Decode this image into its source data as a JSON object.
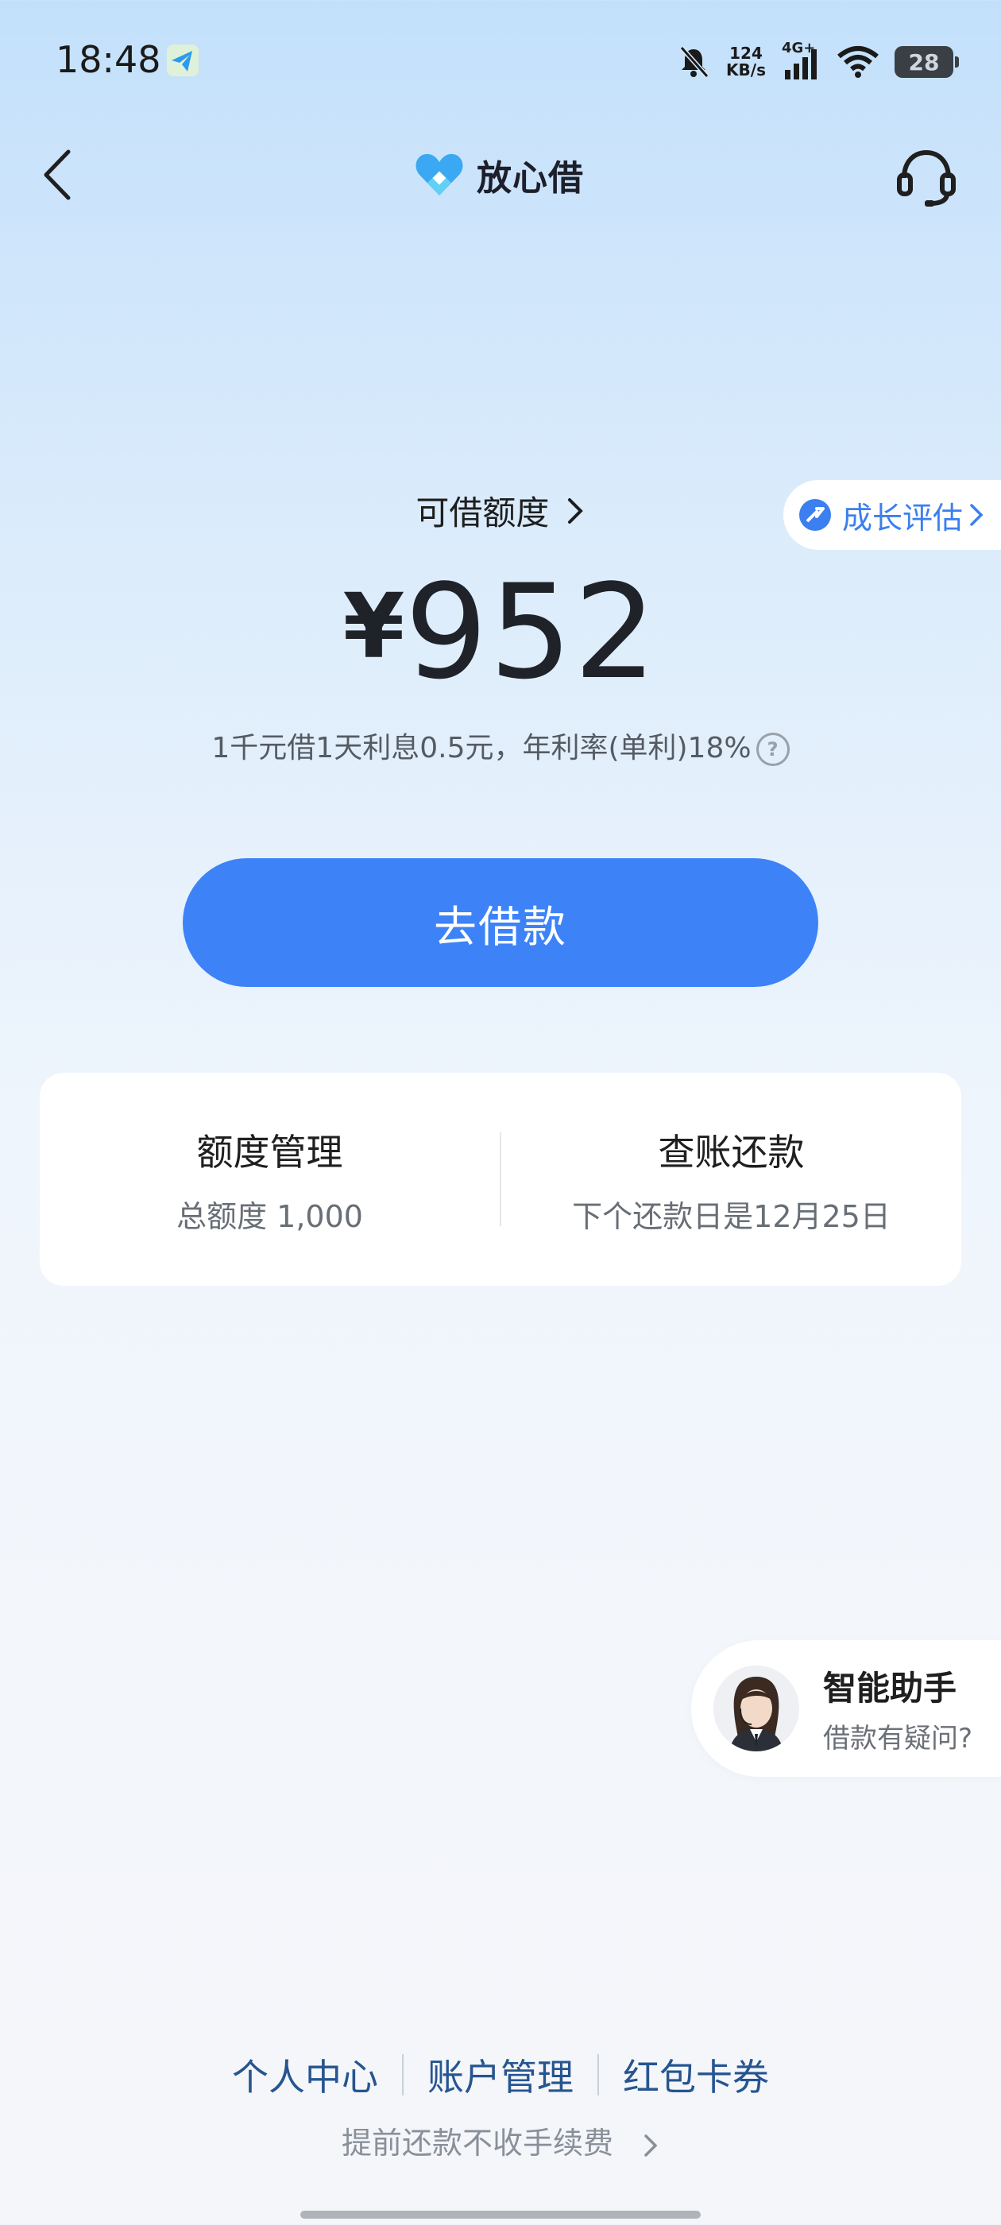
{
  "status_bar": {
    "time": "18:48",
    "net_speed_value": "124",
    "net_speed_unit": "KB/s",
    "network": "4G+",
    "battery": "28",
    "icons": [
      "telegram-icon",
      "mute-bell-icon",
      "signal-icon",
      "wifi-icon",
      "battery-icon"
    ]
  },
  "header": {
    "title": "放心借",
    "logo_icon": "heart-logo-icon",
    "back_icon": "back-chevron-icon",
    "service_icon": "headset-icon"
  },
  "credit": {
    "label": "可借额度",
    "currency": "¥",
    "amount": "952",
    "rate_text": "1千元借1天利息0.5元，年利率(单利)18%"
  },
  "growth_tag": {
    "label": "成长评估"
  },
  "borrow_button": {
    "label": "去借款"
  },
  "cards": [
    {
      "title": "额度管理",
      "subtitle": "总额度 1,000"
    },
    {
      "title": "查账还款",
      "subtitle": "下个还款日是12月25日"
    }
  ],
  "assistant": {
    "title": "智能助手",
    "subtitle": "借款有疑问?"
  },
  "footer": {
    "links": [
      "个人中心",
      "账户管理",
      "红包卡券"
    ],
    "prepay_note": "提前还款不收手续费"
  },
  "colors": {
    "accent": "#3d83f7",
    "link": "#26558f",
    "bg_top": "#c3e0fb",
    "bg_bottom": "#f4f6fa"
  }
}
